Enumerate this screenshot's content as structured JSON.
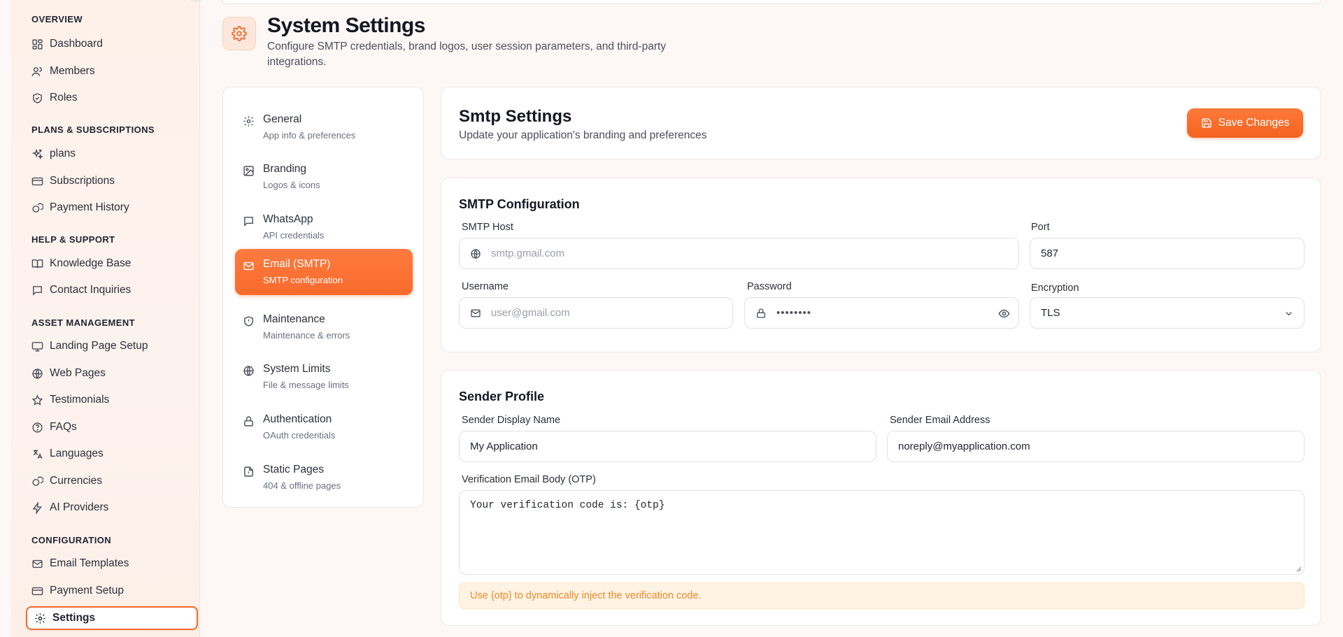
{
  "sidebar": {
    "sections": [
      {
        "title": "OVERVIEW",
        "items": [
          {
            "label": "Dashboard",
            "icon": "dashboard-icon"
          },
          {
            "label": "Members",
            "icon": "users-icon"
          },
          {
            "label": "Roles",
            "icon": "shield-icon"
          }
        ]
      },
      {
        "title": "PLANS & SUBSCRIPTIONS",
        "items": [
          {
            "label": "plans",
            "icon": "sparkles-icon"
          },
          {
            "label": "Subscriptions",
            "icon": "credit-card-icon"
          },
          {
            "label": "Payment History",
            "icon": "coins-icon"
          }
        ]
      },
      {
        "title": "HELP & SUPPORT",
        "items": [
          {
            "label": "Knowledge Base",
            "icon": "book-icon"
          },
          {
            "label": "Contact Inquiries",
            "icon": "message-square-icon"
          }
        ]
      },
      {
        "title": "ASSET MANAGEMENT",
        "items": [
          {
            "label": "Landing Page Setup",
            "icon": "monitor-icon"
          },
          {
            "label": "Web Pages",
            "icon": "globe-icon"
          },
          {
            "label": "Testimonials",
            "icon": "star-icon"
          },
          {
            "label": "FAQs",
            "icon": "help-circle-icon"
          },
          {
            "label": "Languages",
            "icon": "languages-icon"
          },
          {
            "label": "Currencies",
            "icon": "coins-icon"
          },
          {
            "label": "AI Providers",
            "icon": "zap-icon"
          }
        ]
      },
      {
        "title": "CONFIGURATION",
        "items": [
          {
            "label": "Email Templates",
            "icon": "mail-icon"
          },
          {
            "label": "Payment Setup",
            "icon": "credit-card-icon"
          },
          {
            "label": "Settings",
            "icon": "gear-icon",
            "active": true
          }
        ]
      }
    ]
  },
  "header": {
    "title": "System Settings",
    "subtitle": "Configure SMTP credentials, brand logos, user session parameters, and third-party integrations."
  },
  "settings_nav": [
    {
      "title": "General",
      "subtitle": "App info & preferences",
      "icon": "gear-icon"
    },
    {
      "title": "Branding",
      "subtitle": "Logos & icons",
      "icon": "image-icon"
    },
    {
      "title": "WhatsApp",
      "subtitle": "API credentials",
      "icon": "message-square-icon"
    },
    {
      "title": "Email (SMTP)",
      "subtitle": "SMTP configuration",
      "icon": "mail-icon",
      "active": true
    },
    {
      "title": "Maintenance",
      "subtitle": "Maintenance & errors",
      "icon": "shield-icon"
    },
    {
      "title": "System Limits",
      "subtitle": "File & message limits",
      "icon": "globe-icon"
    },
    {
      "title": "Authentication",
      "subtitle": "OAuth credentials",
      "icon": "lock-icon"
    },
    {
      "title": "Static Pages",
      "subtitle": "404 & offline pages",
      "icon": "file-icon"
    }
  ],
  "smtp_header": {
    "title": "Smtp Settings",
    "subtitle": "Update your application's branding and preferences",
    "save_label": "Save Changes"
  },
  "smtp_config": {
    "title": "SMTP Configuration",
    "host_label": "SMTP Host",
    "host_placeholder": "smtp.gmail.com",
    "port_label": "Port",
    "port_value": "587",
    "username_label": "Username",
    "username_placeholder": "user@gmail.com",
    "password_label": "Password",
    "password_value": "••••••••",
    "encryption_label": "Encryption",
    "encryption_value": "TLS"
  },
  "sender_profile": {
    "title": "Sender Profile",
    "display_name_label": "Sender Display Name",
    "display_name_value": "My Application",
    "email_label": "Sender Email Address",
    "email_value": "noreply@myapplication.com",
    "body_label": "Verification Email Body (OTP)",
    "body_value": "Your verification code is: {otp}",
    "hint": "Use {otp} to dynamically inject the verification code."
  },
  "colors": {
    "accent": "#f26a2e",
    "accent_light": "#fde7dc",
    "hint_bg": "#fff3e3",
    "hint_text": "#f08a2a"
  }
}
